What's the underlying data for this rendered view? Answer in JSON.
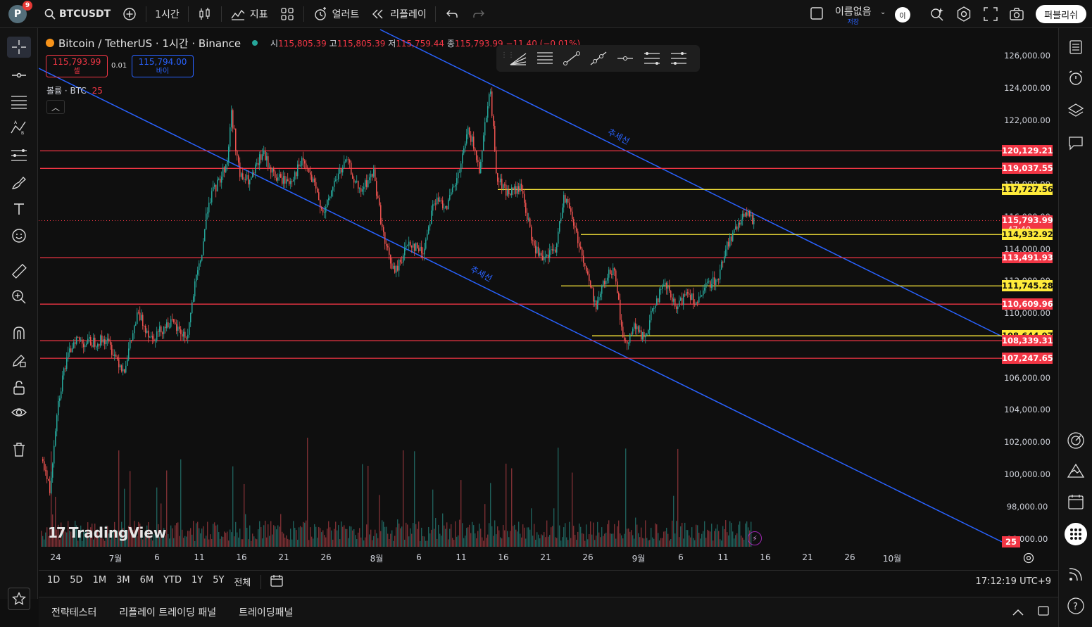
{
  "topbar": {
    "avatar_letter": "P",
    "notification_count": "9",
    "symbol": "BTCUSDT",
    "interval": "1시간",
    "indicators_label": "지표",
    "alerts_label": "얼러트",
    "replay_label": "리플레이",
    "layout_name": "이름없음",
    "layout_sub": "저장",
    "user_badge": "이",
    "publish_label": "퍼블리쉬"
  },
  "legend": {
    "title": "Bitcoin / TetherUS · 1시간 · Binance",
    "open_label": "시",
    "open": "115,805.39",
    "high_label": "고",
    "high": "115,805.39",
    "low_label": "저",
    "low": "115,759.44",
    "close_label": "종",
    "close": "115,793.99",
    "change": "−11.40 (−0.01%)",
    "sell_price": "115,793.99",
    "sell_label": "셀",
    "spread": "0.01",
    "buy_price": "115,794.00",
    "buy_label": "바이",
    "volume_label": "볼륨 · BTC",
    "volume_value": "25"
  },
  "trendline_labels": [
    "추세선",
    "추세선"
  ],
  "price_axis": {
    "ticks": [
      "126,000.00",
      "124,000.00",
      "122,000.00",
      "118,000.00",
      "116,000.00",
      "114,000.00",
      "112,000.00",
      "110,000.00",
      "106,000.00",
      "104,000.00",
      "102,000.00",
      "100,000.00",
      "98,000.00",
      "96,000.00"
    ],
    "levels": [
      {
        "price": 120129.21,
        "label": "120,129.21",
        "color": "red"
      },
      {
        "price": 119037.55,
        "label": "119,037.55",
        "color": "red"
      },
      {
        "price": 117727.56,
        "label": "117,727.56",
        "color": "yellow"
      },
      {
        "price": 115793.99,
        "label": "115,793.99",
        "color": "red",
        "sub": "47:40"
      },
      {
        "price": 114932.92,
        "label": "114,932.92",
        "color": "yellow"
      },
      {
        "price": 113491.93,
        "label": "113,491.93",
        "color": "red"
      },
      {
        "price": 111745.28,
        "label": "111,745.28",
        "color": "yellow"
      },
      {
        "price": 110609.96,
        "label": "110,609.96",
        "color": "red"
      },
      {
        "price": 108644.97,
        "label": "108,644.97",
        "color": "yellow"
      },
      {
        "price": 108339.31,
        "label": "108,339.31",
        "color": "red"
      },
      {
        "price": 107247.65,
        "label": "107,247.65",
        "color": "red"
      }
    ],
    "volume_badge": "25"
  },
  "time_axis": [
    "24",
    "7월",
    "6",
    "11",
    "16",
    "21",
    "26",
    "8월",
    "6",
    "11",
    "16",
    "21",
    "26",
    "9월",
    "6",
    "11",
    "16",
    "21",
    "26",
    "10월"
  ],
  "range_buttons": [
    "1D",
    "5D",
    "1M",
    "3M",
    "6M",
    "YTD",
    "1Y",
    "5Y",
    "전체"
  ],
  "clock": "17:12:19 UTC+9",
  "bottom_tabs": [
    "전략테스터",
    "리플레이 트레이딩 패널",
    "트레이딩패널"
  ],
  "brand": "TradingView",
  "colors": {
    "background": "#0f0f0f",
    "red_level": "#f23645",
    "yellow_level": "#ffeb3b",
    "trendline": "#2962ff",
    "candle_up": "#26a69a",
    "candle_down": "#ef5350"
  }
}
